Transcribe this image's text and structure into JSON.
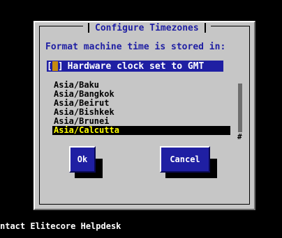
{
  "dialog": {
    "title": "Configure Timezones",
    "prompt": "Format machine time is stored in:",
    "checkbox": {
      "label": "Hardware clock set to GMT",
      "open": "[",
      "close": "]"
    },
    "timezones": [
      "Asia/Baku",
      "Asia/Bangkok",
      "Asia/Beirut",
      "Asia/Bishkek",
      "Asia/Brunei",
      "Asia/Calcutta"
    ],
    "selected_timezone": "Asia/Calcutta",
    "scroll_marker": "#",
    "buttons": {
      "ok": "Ok",
      "cancel": "Cancel"
    }
  },
  "footer": {
    "text": "ntact Elitecore Helpdesk"
  },
  "colors": {
    "background": "#000000",
    "dialog": "#c6c6c6",
    "accent": "#1f1fa3",
    "highlight_text": "#ffff00",
    "checkbox_cursor": "#c58b10"
  }
}
